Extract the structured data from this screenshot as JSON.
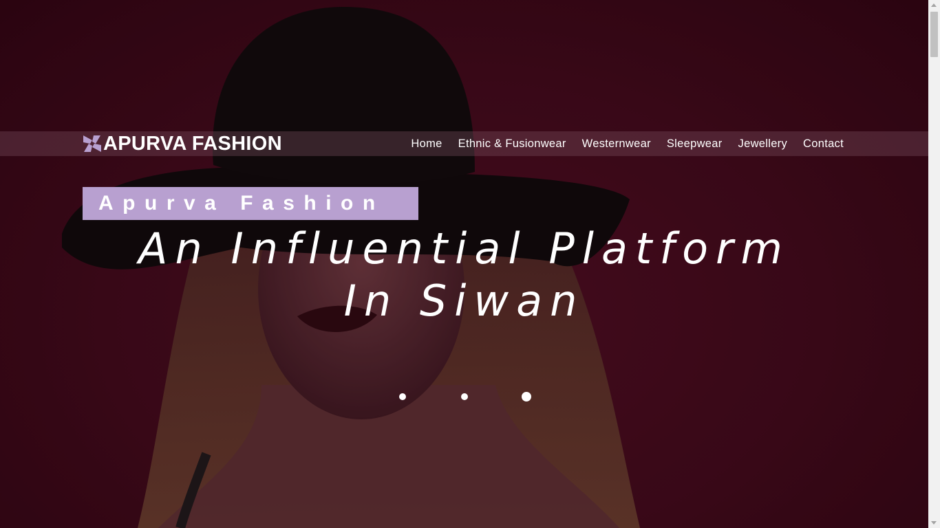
{
  "brand": {
    "name": "APURVA FASHION",
    "logo_icon": "pinwheel-logo-icon"
  },
  "nav": {
    "items": [
      {
        "label": "Home"
      },
      {
        "label": "Ethnic & Fusionwear"
      },
      {
        "label": "Westernwear"
      },
      {
        "label": "Sleepwear"
      },
      {
        "label": "Jewellery"
      },
      {
        "label": "Contact"
      }
    ]
  },
  "hero": {
    "subtitle": "Apurva Fashion",
    "headline_line1": "An Influential Platform",
    "headline_line2": "In Siwan",
    "slide_count": 3,
    "active_slide": 3
  },
  "colors": {
    "background": "#3c0a1a",
    "accent": "#b8a0d0",
    "text": "#ffffff"
  }
}
